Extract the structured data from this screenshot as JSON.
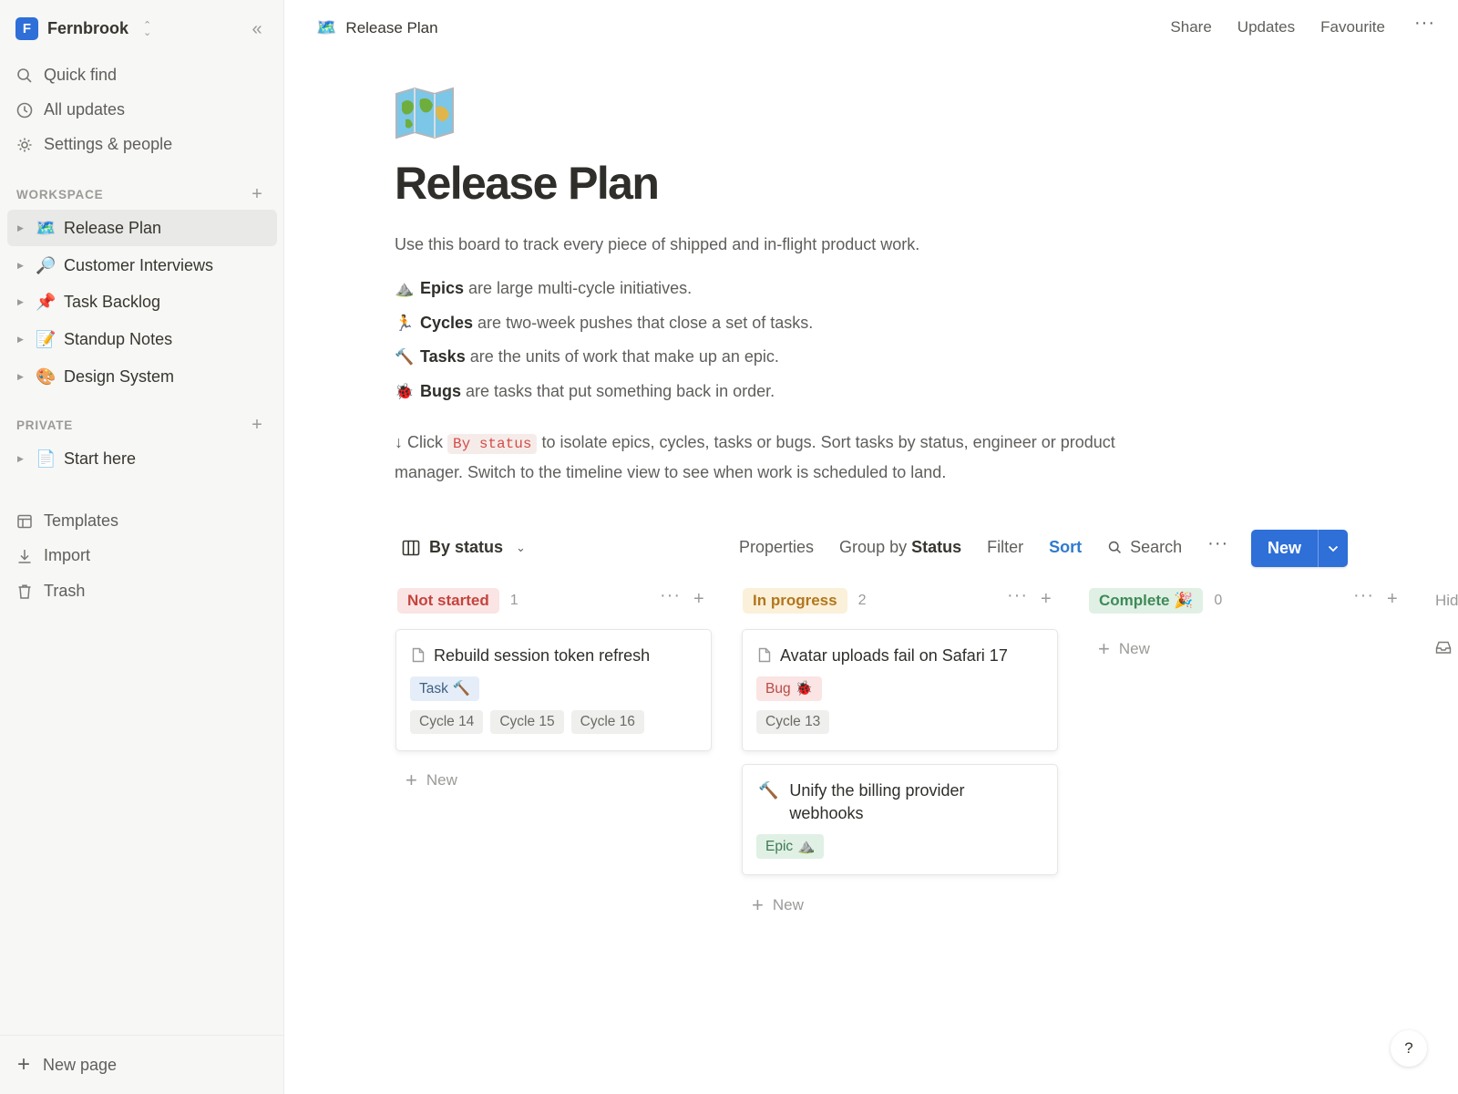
{
  "workspace": {
    "initial": "F",
    "name": "Fernbrook"
  },
  "sidebar": {
    "nav": [
      {
        "label": "Quick find",
        "icon": "search-icon"
      },
      {
        "label": "All updates",
        "icon": "clock-icon"
      },
      {
        "label": "Settings & people",
        "icon": "gear-icon"
      }
    ],
    "workspace_label": "WORKSPACE",
    "workspace_pages": [
      {
        "emoji": "🗺️",
        "label": "Release Plan",
        "active": true
      },
      {
        "emoji": "🔎",
        "label": "Customer Interviews"
      },
      {
        "emoji": "📌",
        "label": "Task Backlog"
      },
      {
        "emoji": "📝",
        "label": "Standup Notes"
      },
      {
        "emoji": "🎨",
        "label": "Design System"
      }
    ],
    "private_label": "PRIVATE",
    "private_pages": [
      {
        "emoji": "📄",
        "label": "Start here"
      }
    ],
    "utilities": [
      {
        "label": "Templates",
        "icon": "templates-icon"
      },
      {
        "label": "Import",
        "icon": "import-icon"
      },
      {
        "label": "Trash",
        "icon": "trash-icon"
      }
    ],
    "new_page": "New page"
  },
  "topbar": {
    "emoji": "🗺️",
    "title": "Release Plan",
    "share": "Share",
    "updates": "Updates",
    "favourite": "Favourite",
    "more": "···"
  },
  "page": {
    "icon": "map-icon",
    "title": "Release Plan",
    "lead": "Use this board to track every piece of shipped and in-flight product work.",
    "legend": [
      {
        "emoji": "⛰️",
        "term": "Epics",
        "text": "are large multi-cycle initiatives."
      },
      {
        "emoji": "🏃",
        "term": "Cycles",
        "text": "are two-week pushes that close a set of tasks."
      },
      {
        "emoji": "🔨",
        "term": "Tasks",
        "text": "are the units of work that make up an epic."
      },
      {
        "emoji": "🐞",
        "term": "Bugs",
        "text": "are tasks that put something back in order."
      }
    ],
    "hint_prefix": "↓ Click",
    "hint_code": "By status",
    "hint_suffix": "to isolate epics, cycles, tasks or bugs. Sort tasks by status, engineer or product manager. Switch to the timeline view to see when work is scheduled to land."
  },
  "board": {
    "view_label": "By status",
    "properties": "Properties",
    "group_by_prefix": "Group by",
    "group_by_value": "Status",
    "filter": "Filter",
    "sort": "Sort",
    "search": "Search",
    "more": "···",
    "new_label": "New",
    "hidden_label": "Hid",
    "columns": [
      {
        "status": "Not started",
        "count": "1",
        "cards": [
          {
            "title": "Rebuild session token refresh",
            "type": "Task",
            "type_emoji": "🔨",
            "cycles": [
              "Cycle 14",
              "Cycle 15",
              "Cycle 16"
            ]
          }
        ]
      },
      {
        "status": "In progress",
        "count": "2",
        "cards": [
          {
            "title": "Avatar uploads fail on Safari 17",
            "type": "Bug",
            "type_emoji": "🐞",
            "cycles": [
              "Cycle 13"
            ]
          },
          {
            "title_emoji": "🔨",
            "title": "Unify the billing provider webhooks",
            "type": "Epic",
            "type_emoji": "⛰️"
          }
        ]
      },
      {
        "status": "Complete",
        "status_emoji": "🎉",
        "count": "0",
        "cards": []
      }
    ],
    "add_new": "New"
  },
  "help": "?",
  "colors": {
    "accent": "#2e6fd8",
    "sort_blue": "#2f7ad0",
    "not_started": "#fbe4e4",
    "in_progress": "#fbf0d9",
    "complete": "#e0f0e5"
  }
}
